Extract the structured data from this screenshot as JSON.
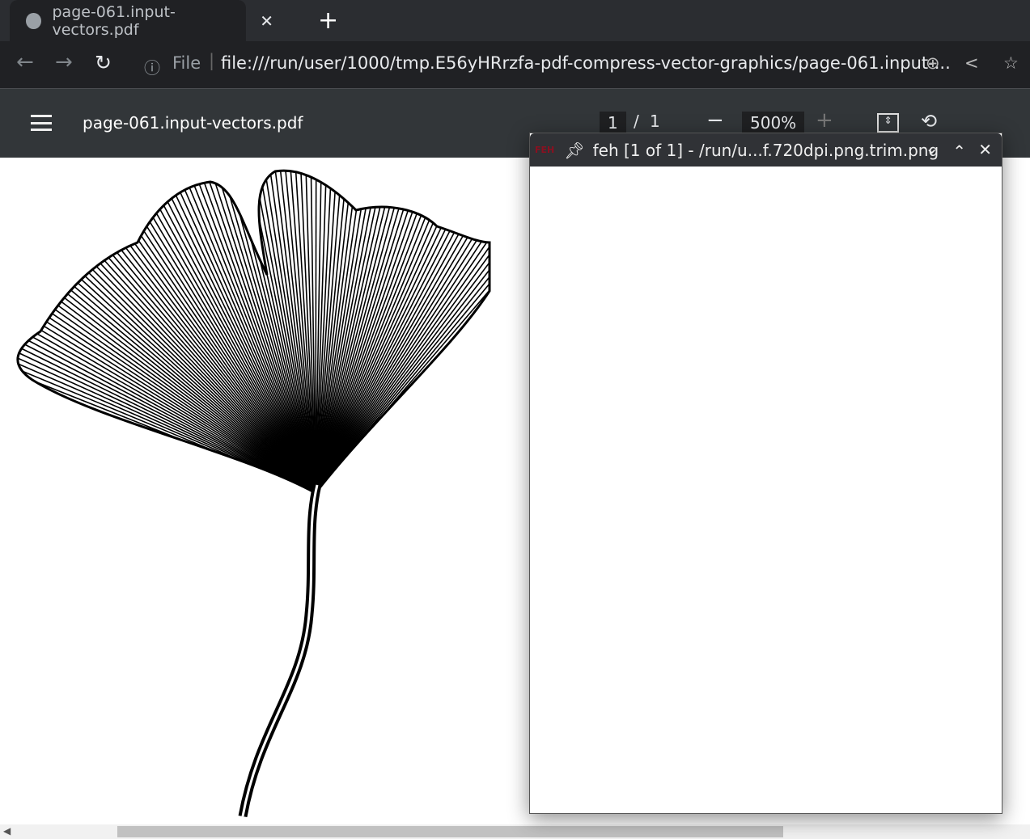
{
  "browser": {
    "tab_title": "page-061.input-vectors.pdf",
    "url_scheme_label": "File",
    "url": "file:///run/user/1000/tmp.E56yHRrzfa-pdf-compress-vector-graphics/page-061.input-..."
  },
  "pdf": {
    "title": "page-061.input-vectors.pdf",
    "page_current": "1",
    "page_sep": "/",
    "page_total": "1",
    "zoom": "500%"
  },
  "feh": {
    "logo": "FEH",
    "title": "feh [1 of 1] - /run/u...f.720dpi.png.trim.png"
  }
}
